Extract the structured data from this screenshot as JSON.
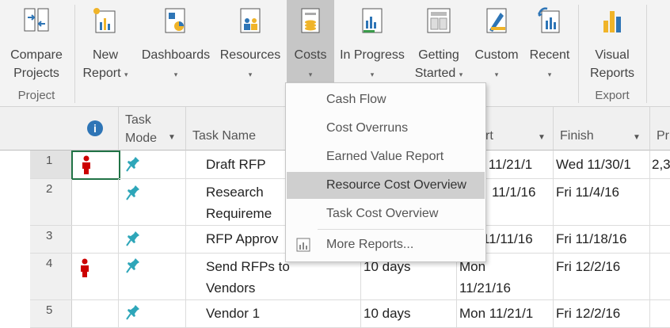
{
  "ribbon": {
    "buttons": [
      {
        "label1": "Compare",
        "label2": "Projects",
        "caret": ""
      },
      {
        "label1": "New",
        "label2": "Report",
        "caret": "▾"
      },
      {
        "label1": "Dashboards",
        "label2": "",
        "caret": "▾"
      },
      {
        "label1": "Resources",
        "label2": "",
        "caret": "▾"
      },
      {
        "label1": "Costs",
        "label2": "",
        "caret": "▾"
      },
      {
        "label1": "In Progress",
        "label2": "",
        "caret": "▾"
      },
      {
        "label1": "Getting",
        "label2": "Started",
        "caret": "▾"
      },
      {
        "label1": "Custom",
        "label2": "",
        "caret": "▾"
      },
      {
        "label1": "Recent",
        "label2": "",
        "caret": "▾"
      },
      {
        "label1": "Visual",
        "label2": "Reports",
        "caret": ""
      }
    ],
    "groups": {
      "project": "Project",
      "export": "Export"
    },
    "colors": {
      "accent": "#2e75b6",
      "chart_gold": "#f0b429",
      "active_bg": "#c6c6c6"
    }
  },
  "grid": {
    "headers": {
      "info": "i",
      "task_mode1": "Task",
      "task_mode2": "Mode",
      "task_name": "Task Name",
      "start": "rt",
      "finish": "Finish",
      "extra": "Pr"
    },
    "rows": [
      {
        "num": "1",
        "indicator": true,
        "name1": "Draft RFP",
        "name2": "",
        "duration": "",
        "start1": "Mon 11/21/1",
        "start2": "",
        "finish": "Wed 11/30/1",
        "extra": "2,3"
      },
      {
        "num": "2",
        "indicator": false,
        "name1": "Research",
        "name2": "Requireme",
        "duration": "",
        "start1": "11/1/16",
        "start2": "",
        "finish": "Fri 11/4/16",
        "extra": ""
      },
      {
        "num": "3",
        "indicator": false,
        "name1": "RFP Approv",
        "name2": "",
        "duration": "",
        "start1": "11/11/16",
        "start2": "",
        "finish": "Fri 11/18/16",
        "extra": ""
      },
      {
        "num": "4",
        "indicator": true,
        "name1": "Send RFPs to",
        "name2": "Vendors",
        "duration": "10 days",
        "start1": "Mon",
        "start2": "11/21/16",
        "finish": "Fri 12/2/16",
        "extra": ""
      },
      {
        "num": "5",
        "indicator": false,
        "name1": "Vendor 1",
        "name2": "",
        "duration": "10 days",
        "start1": "Mon 11/21/1",
        "start2": "",
        "finish": "Fri 12/2/16",
        "extra": ""
      }
    ]
  },
  "costs_menu": {
    "items": [
      "Cash Flow",
      "Cost Overruns",
      "Earned Value Report",
      "Resource Cost Overview",
      "Task Cost Overview"
    ],
    "more": "More Reports...",
    "highlighted": "Resource Cost Overview"
  }
}
